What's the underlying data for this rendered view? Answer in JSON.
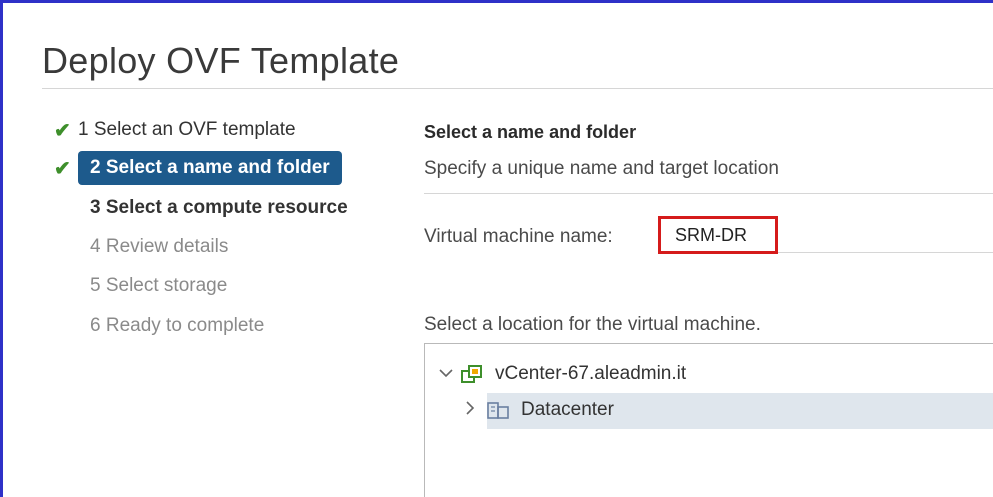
{
  "dialog": {
    "title": "Deploy OVF Template"
  },
  "steps": [
    {
      "label": "1 Select an OVF template",
      "state": "done"
    },
    {
      "label": "2 Select a name and folder",
      "state": "current"
    },
    {
      "label": "3 Select a compute resource",
      "state": "next"
    },
    {
      "label": "4 Review details",
      "state": "todo"
    },
    {
      "label": "5 Select storage",
      "state": "todo"
    },
    {
      "label": "6 Ready to complete",
      "state": "todo"
    }
  ],
  "page": {
    "section_title": "Select a name and folder",
    "subtitle": "Specify a unique name and target location",
    "vm_name_label": "Virtual machine name:",
    "vm_name_value": "SRM-DR",
    "location_label": "Select a location for the virtual machine."
  },
  "tree": [
    {
      "label": "vCenter-67.aleadmin.it",
      "icon": "vcenter-icon",
      "expanded": true
    },
    {
      "label": "Datacenter",
      "icon": "datacenter-icon",
      "expanded": false,
      "selected": true
    }
  ],
  "colors": {
    "accent": "#1d5a8c",
    "check": "#3e8f2b",
    "highlight_box": "#d51b1b",
    "selected_row": "#dfe6ed"
  }
}
